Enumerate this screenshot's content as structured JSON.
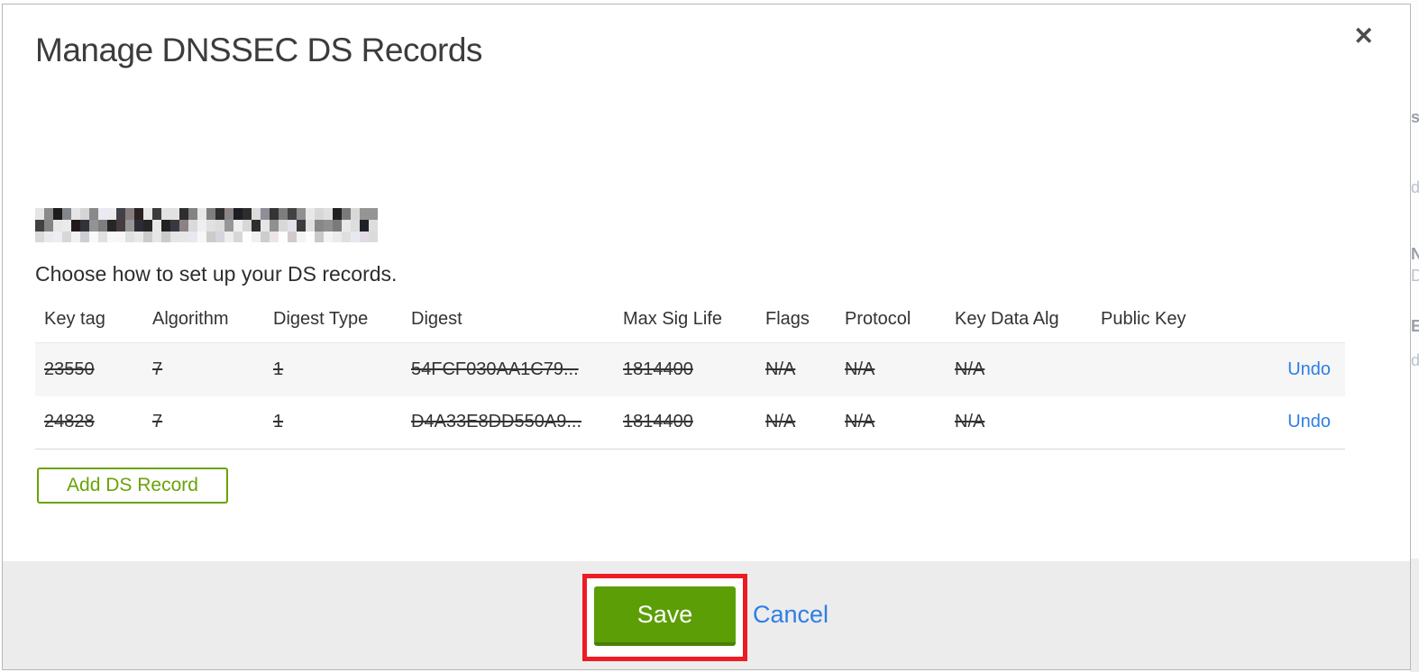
{
  "colors": {
    "accent_green": "#5c9e06",
    "accent_green_dark": "#4a8005",
    "outline_green": "#6aa306",
    "link_blue": "#2e7ee4",
    "annotation_red": "#ed1c24",
    "footer_bg": "#ececec",
    "alt_row_bg": "#f6f6f6"
  },
  "modal": {
    "title": "Manage DNSSEC DS Records",
    "close_icon": "✕",
    "domain_note": "redacted",
    "subtitle": "Choose how to set up your DS records.",
    "add_ds_record_label": "Add DS Record",
    "save_label": "Save",
    "cancel_label": "Cancel"
  },
  "table": {
    "headers": [
      "Key tag",
      "Algorithm",
      "Digest Type",
      "Digest",
      "Max Sig Life",
      "Flags",
      "Protocol",
      "Key Data Alg",
      "Public Key"
    ],
    "rows": [
      {
        "key_tag": "23550",
        "algorithm": "7",
        "digest_type": "1",
        "digest": "54FCF030AA1C79...",
        "max_sig_life": "1814400",
        "flags": "N/A",
        "protocol": "N/A",
        "key_data_alg": "N/A",
        "public_key": "",
        "action": "Undo",
        "struck": true
      },
      {
        "key_tag": "24828",
        "algorithm": "7",
        "digest_type": "1",
        "digest": "D4A33E8DD550A9...",
        "max_sig_life": "1814400",
        "flags": "N/A",
        "protocol": "N/A",
        "key_data_alg": "N/A",
        "public_key": "",
        "action": "Undo",
        "struck": true
      }
    ]
  },
  "edge": {
    "fragments": [
      "s",
      "d",
      "N",
      "D",
      "E",
      "d"
    ]
  }
}
